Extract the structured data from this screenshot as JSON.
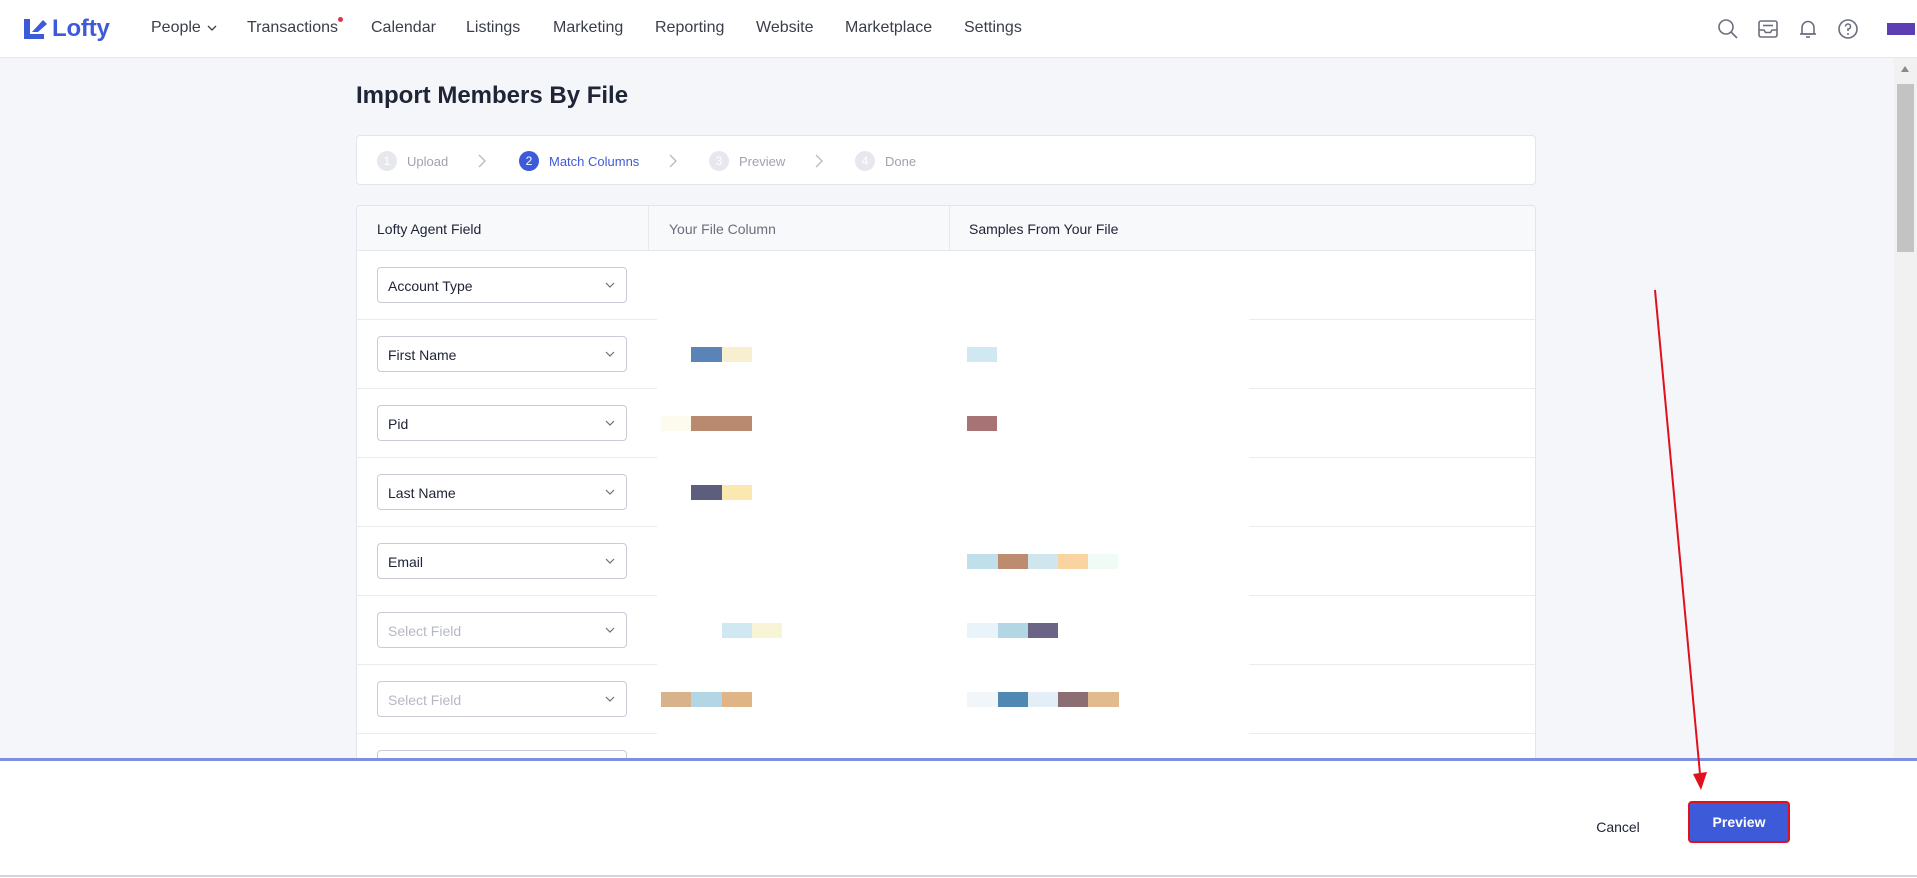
{
  "app": {
    "logo_text": "Lofty"
  },
  "nav": {
    "items": [
      {
        "label": "People"
      },
      {
        "label": "Transactions"
      },
      {
        "label": "Calendar"
      },
      {
        "label": "Listings"
      },
      {
        "label": "Marketing"
      },
      {
        "label": "Reporting"
      },
      {
        "label": "Website"
      },
      {
        "label": "Marketplace"
      },
      {
        "label": "Settings"
      }
    ],
    "tools": [
      "search-icon",
      "inbox-icon",
      "bell-icon",
      "help-icon"
    ],
    "accent": "#3d5bd9"
  },
  "page": {
    "title": "Import Members By File"
  },
  "steps": [
    {
      "num": "1",
      "label": "Upload"
    },
    {
      "num": "2",
      "label": "Match Columns"
    },
    {
      "num": "3",
      "label": "Preview"
    },
    {
      "num": "4",
      "label": "Done"
    }
  ],
  "table": {
    "headers": {
      "agent_field": "Lofty Agent Field",
      "file_column": "Your File Column",
      "samples": "Samples From Your File"
    },
    "rows": [
      {
        "field": "Account Type"
      },
      {
        "field": "First Name"
      },
      {
        "field": "Pid"
      },
      {
        "field": "Last Name"
      },
      {
        "field": "Email"
      },
      {
        "field": "Select Field"
      },
      {
        "field": "Select Field"
      },
      {
        "field": ""
      }
    ]
  },
  "footer": {
    "cancel_label": "Cancel",
    "preview_label": "Preview"
  }
}
